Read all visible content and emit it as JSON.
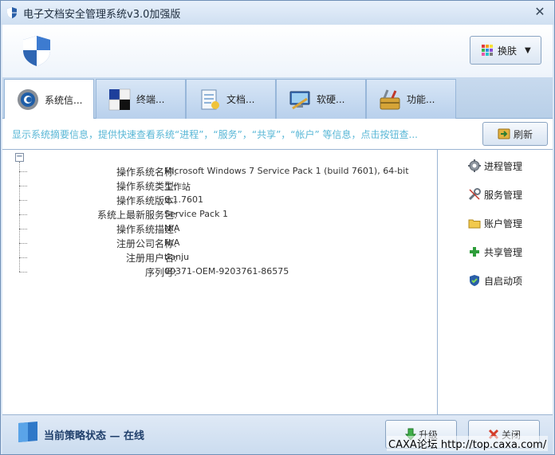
{
  "window": {
    "title": "电子文档安全管理系统v3.0加强版",
    "close_glyph": "✕"
  },
  "header": {
    "skin_label": "换肤"
  },
  "tabs": [
    {
      "label": "系统信...",
      "icon": "system-info-icon",
      "active": true
    },
    {
      "label": "终端...",
      "icon": "terminal-icon",
      "active": false
    },
    {
      "label": "文档...",
      "icon": "document-icon",
      "active": false
    },
    {
      "label": "软硬...",
      "icon": "hardware-icon",
      "active": false
    },
    {
      "label": "功能...",
      "icon": "tools-icon",
      "active": false
    }
  ],
  "info": {
    "text": "显示系统摘要信息，提供快速查看系统“进程”，“服务”，“共享”，“帐户” 等信息，点击按钮查...",
    "refresh_label": "刷新"
  },
  "tree": {
    "toggle": "−",
    "rows": [
      {
        "label": "操作系统名称:",
        "value": "Microsoft Windows 7  Service Pack 1 (build 7601), 64-bit"
      },
      {
        "label": "操作系统类型:",
        "value": "工作站"
      },
      {
        "label": "操作系统版本:",
        "value": "6.1.7601"
      },
      {
        "label": "系统上最新服务包:",
        "value": "Service Pack 1"
      },
      {
        "label": "操作系统描述:",
        "value": "N/A"
      },
      {
        "label": "注册公司名称:",
        "value": "N/A"
      },
      {
        "label": "注册用户名:",
        "value": "tianju"
      },
      {
        "label": "序列号:",
        "value": "00371-OEM-9203761-86575"
      }
    ]
  },
  "side_actions": [
    {
      "label": "进程管理",
      "icon": "gear-icon"
    },
    {
      "label": "服务管理",
      "icon": "wrench-icon"
    },
    {
      "label": "账户管理",
      "icon": "folder-icon"
    },
    {
      "label": "共享管理",
      "icon": "plus-icon"
    },
    {
      "label": "自启动项",
      "icon": "shield-icon"
    }
  ],
  "footer": {
    "status_text": "当前策略状态 — 在线",
    "upgrade_label": "升级",
    "close_label": "关闭",
    "watermark": "CAXA论坛  http://top.caxa.com/"
  },
  "colors": {
    "accent": "#59b7d6",
    "window_bg": "#dbe7f5",
    "tab_border": "#97b6d9"
  }
}
